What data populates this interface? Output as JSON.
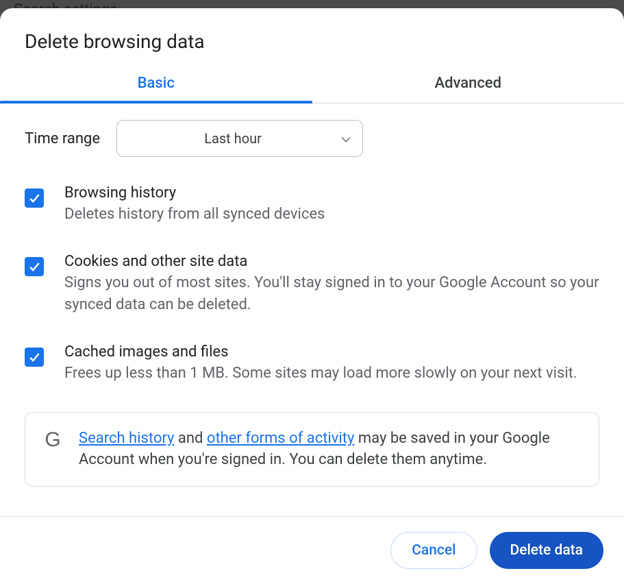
{
  "background": {
    "text": "Search settings"
  },
  "dialog": {
    "title": "Delete browsing data"
  },
  "tabs": {
    "basic": "Basic",
    "advanced": "Advanced"
  },
  "timeRange": {
    "label": "Time range",
    "selected": "Last hour"
  },
  "options": {
    "browsingHistory": {
      "title": "Browsing history",
      "desc": "Deletes history from all synced devices"
    },
    "cookies": {
      "title": "Cookies and other site data",
      "desc": "Signs you out of most sites. You'll stay signed in to your Google Account so your synced data can be deleted."
    },
    "cache": {
      "title": "Cached images and files",
      "desc": "Frees up less than 1 MB. Some sites may load more slowly on your next visit."
    }
  },
  "info": {
    "link1": "Search history",
    "mid1": " and ",
    "link2": "other forms of activity",
    "rest": " may be saved in your Google Account when you're signed in. You can delete them anytime."
  },
  "footer": {
    "cancel": "Cancel",
    "delete": "Delete data"
  }
}
